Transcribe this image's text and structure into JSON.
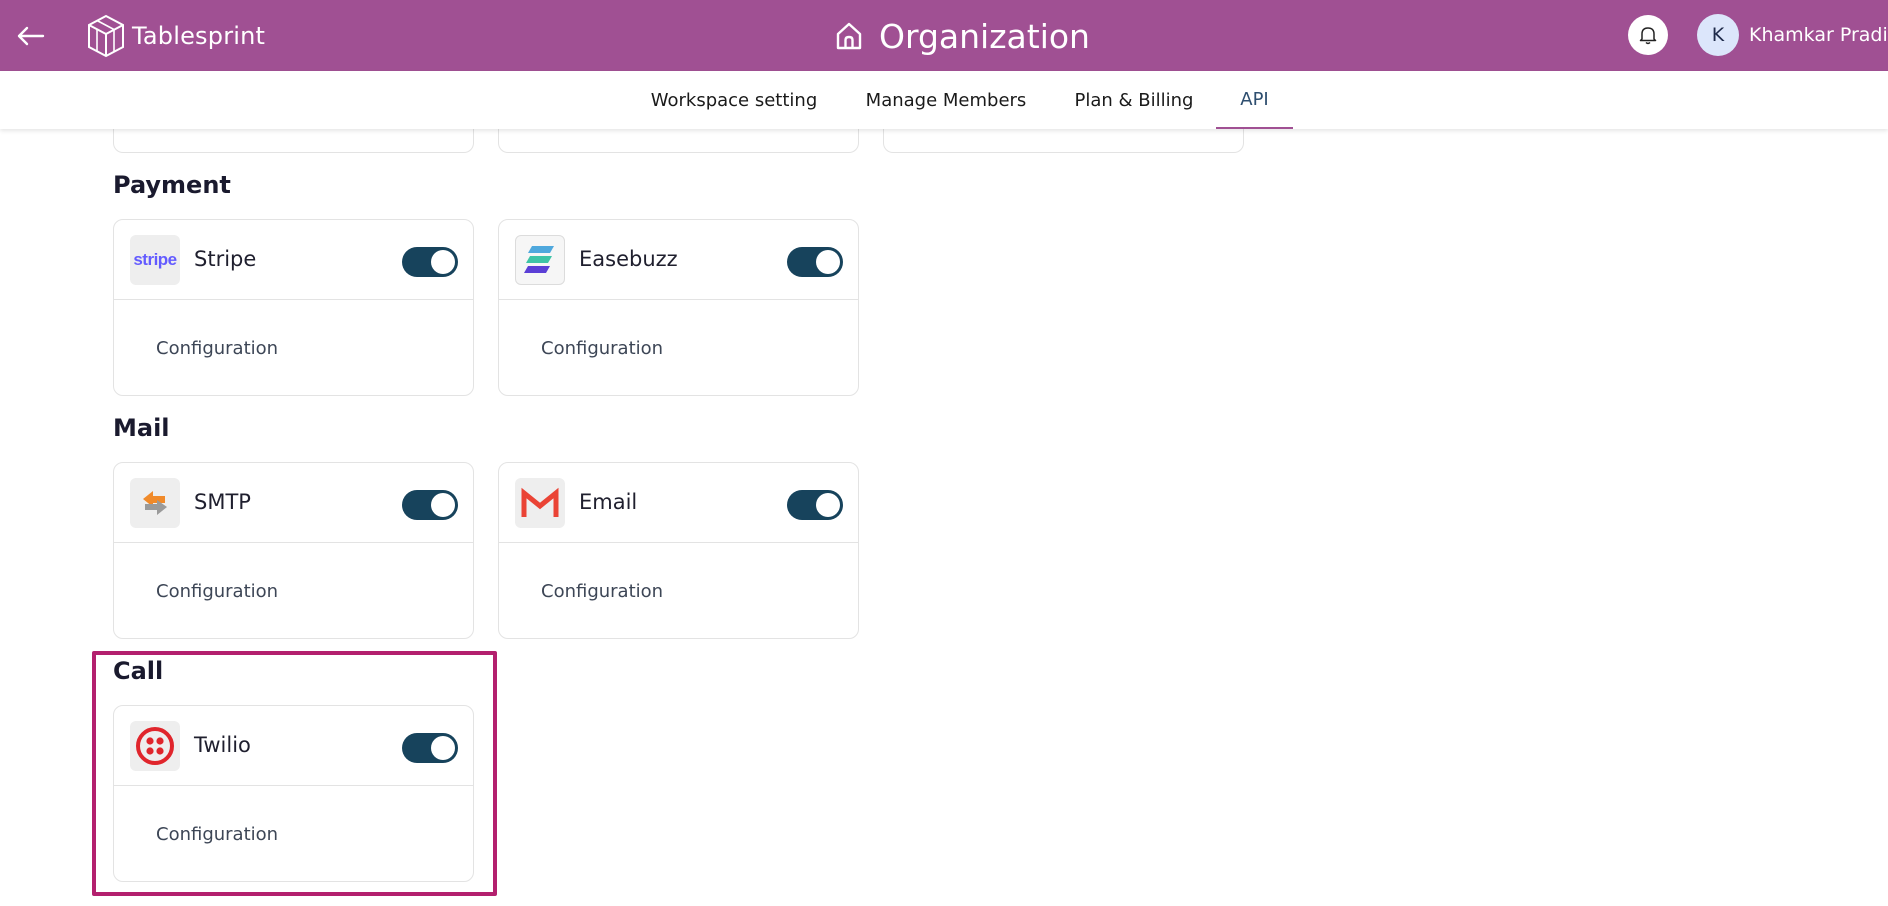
{
  "header": {
    "brand": "Tablesprint",
    "title": "Organization",
    "user_initial": "K",
    "user_name": "Khamkar Pradip"
  },
  "tabs": [
    {
      "label": "Workspace setting"
    },
    {
      "label": "Manage Members"
    },
    {
      "label": "Plan & Billing"
    },
    {
      "label": "API",
      "active": true
    }
  ],
  "sections": {
    "payment": {
      "title": "Payment",
      "cards": [
        {
          "name": "Stripe",
          "enabled": true,
          "config_label": "Configuration",
          "icon": "stripe-logo"
        },
        {
          "name": "Easebuzz",
          "enabled": true,
          "config_label": "Configuration",
          "icon": "easebuzz-logo"
        }
      ]
    },
    "mail": {
      "title": "Mail",
      "cards": [
        {
          "name": "SMTP",
          "enabled": true,
          "config_label": "Configuration",
          "icon": "smtp-logo"
        },
        {
          "name": "Email",
          "enabled": true,
          "config_label": "Configuration",
          "icon": "gmail-logo"
        }
      ]
    },
    "call": {
      "title": "Call",
      "cards": [
        {
          "name": "Twilio",
          "enabled": true,
          "config_label": "Configuration",
          "icon": "twilio-logo"
        }
      ]
    }
  },
  "stripe_logo_text": "stripe",
  "colors": {
    "header_bg": "#a05093",
    "toggle_on": "#17435c",
    "active_tab_text": "#2e4e6f",
    "highlight_border": "#b3206e"
  }
}
